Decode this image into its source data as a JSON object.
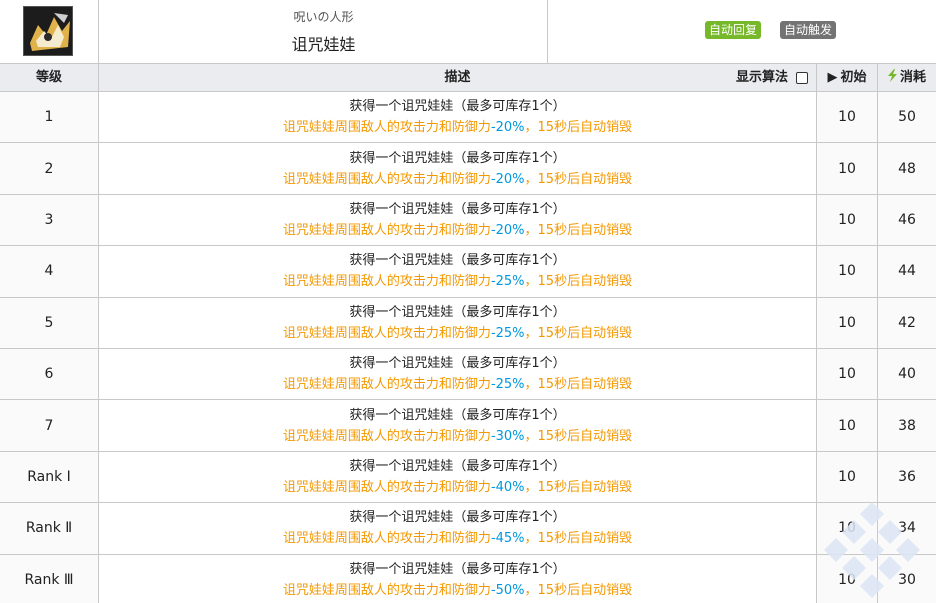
{
  "skill": {
    "icon": "cursed-doll-skill-icon",
    "subname": "呪いの人形",
    "name": "诅咒娃娃",
    "tags": [
      "自动回复",
      "自动触发"
    ]
  },
  "table": {
    "headers": {
      "level": "等级",
      "description": "描述",
      "show_formula": "显示算法",
      "initial": "初始",
      "cost": "消耗"
    },
    "rows": [
      {
        "level": "1",
        "line1": "获得一个诅咒娃娃（最多可库存1个）",
        "line2_pre": "诅咒娃娃周围敌人的攻击力和防御力",
        "line2_pct": "-20%",
        "line2_post": "，15秒后自动销毁",
        "initial": "10",
        "cost": "50"
      },
      {
        "level": "2",
        "line1": "获得一个诅咒娃娃（最多可库存1个）",
        "line2_pre": "诅咒娃娃周围敌人的攻击力和防御力",
        "line2_pct": "-20%",
        "line2_post": "，15秒后自动销毁",
        "initial": "10",
        "cost": "48"
      },
      {
        "level": "3",
        "line1": "获得一个诅咒娃娃（最多可库存1个）",
        "line2_pre": "诅咒娃娃周围敌人的攻击力和防御力",
        "line2_pct": "-20%",
        "line2_post": "，15秒后自动销毁",
        "initial": "10",
        "cost": "46"
      },
      {
        "level": "4",
        "line1": "获得一个诅咒娃娃（最多可库存1个）",
        "line2_pre": "诅咒娃娃周围敌人的攻击力和防御力",
        "line2_pct": "-25%",
        "line2_post": "，15秒后自动销毁",
        "initial": "10",
        "cost": "44"
      },
      {
        "level": "5",
        "line1": "获得一个诅咒娃娃（最多可库存1个）",
        "line2_pre": "诅咒娃娃周围敌人的攻击力和防御力",
        "line2_pct": "-25%",
        "line2_post": "，15秒后自动销毁",
        "initial": "10",
        "cost": "42"
      },
      {
        "level": "6",
        "line1": "获得一个诅咒娃娃（最多可库存1个）",
        "line2_pre": "诅咒娃娃周围敌人的攻击力和防御力",
        "line2_pct": "-25%",
        "line2_post": "，15秒后自动销毁",
        "initial": "10",
        "cost": "40"
      },
      {
        "level": "7",
        "line1": "获得一个诅咒娃娃（最多可库存1个）",
        "line2_pre": "诅咒娃娃周围敌人的攻击力和防御力",
        "line2_pct": "-30%",
        "line2_post": "，15秒后自动销毁",
        "initial": "10",
        "cost": "38"
      },
      {
        "level": "Rank Ⅰ",
        "line1": "获得一个诅咒娃娃（最多可库存1个）",
        "line2_pre": "诅咒娃娃周围敌人的攻击力和防御力",
        "line2_pct": "-40%",
        "line2_post": "，15秒后自动销毁",
        "initial": "10",
        "cost": "36"
      },
      {
        "level": "Rank Ⅱ",
        "line1": "获得一个诅咒娃娃（最多可库存1个）",
        "line2_pre": "诅咒娃娃周围敌人的攻击力和防御力",
        "line2_pct": "-45%",
        "line2_post": "，15秒后自动销毁",
        "initial": "10",
        "cost": "34"
      },
      {
        "level": "Rank Ⅲ",
        "line1": "获得一个诅咒娃娃（最多可库存1个）",
        "line2_pre": "诅咒娃娃周围敌人的攻击力和防御力",
        "line2_pct": "-50%",
        "line2_post": "，15秒后自动销毁",
        "initial": "10",
        "cost": "30"
      }
    ]
  },
  "colors": {
    "effect_text": "#f49800",
    "percent_text": "#0098dc",
    "tag_auto_recovery": "#76b82a",
    "tag_auto_trigger": "#737373"
  }
}
